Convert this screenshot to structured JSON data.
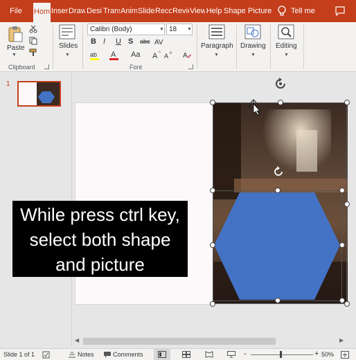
{
  "tabs": [
    {
      "label": "File",
      "active": false
    },
    {
      "label": "Hom",
      "active": true
    },
    {
      "label": "Inser",
      "active": false
    },
    {
      "label": "Draw",
      "active": false
    },
    {
      "label": "Desi",
      "active": false
    },
    {
      "label": "Trans",
      "active": false
    },
    {
      "label": "Anim",
      "active": false
    },
    {
      "label": "Slide",
      "active": false
    },
    {
      "label": "Reco",
      "active": false
    },
    {
      "label": "Revie",
      "active": false
    },
    {
      "label": "View",
      "active": false
    },
    {
      "label": "Help",
      "active": false
    },
    {
      "label": "Shape",
      "active": false
    },
    {
      "label": "Picture",
      "active": false
    }
  ],
  "tell_me": "Tell me",
  "ribbon": {
    "clipboard": {
      "paste": "Paste",
      "group": "Clipboard"
    },
    "slides": {
      "label": "Slides"
    },
    "font": {
      "name": "Calibri (Body)",
      "size": "18",
      "group": "Font",
      "bold": "B",
      "italic": "I",
      "underline": "U",
      "shadow": "S",
      "strike": "abc",
      "case": "Aa"
    },
    "paragraph": {
      "label": "Paragraph"
    },
    "drawing": {
      "label": "Drawing"
    },
    "editing": {
      "label": "Editing"
    }
  },
  "thumbnail": {
    "number": "1"
  },
  "caption": {
    "line1": "While press ctrl key,",
    "line2": "select both shape",
    "line3": "and picture"
  },
  "status": {
    "slide": "Slide 1 of 1",
    "notes": "Notes",
    "comments": "Comments",
    "zoom": "50%",
    "zoom_minus": "-",
    "zoom_plus": "+"
  },
  "colors": {
    "accent": "#c43e1c",
    "hexagon": "#4472c4",
    "font_color_bar": "#e02020",
    "highlight_bar": "#ffff00"
  }
}
